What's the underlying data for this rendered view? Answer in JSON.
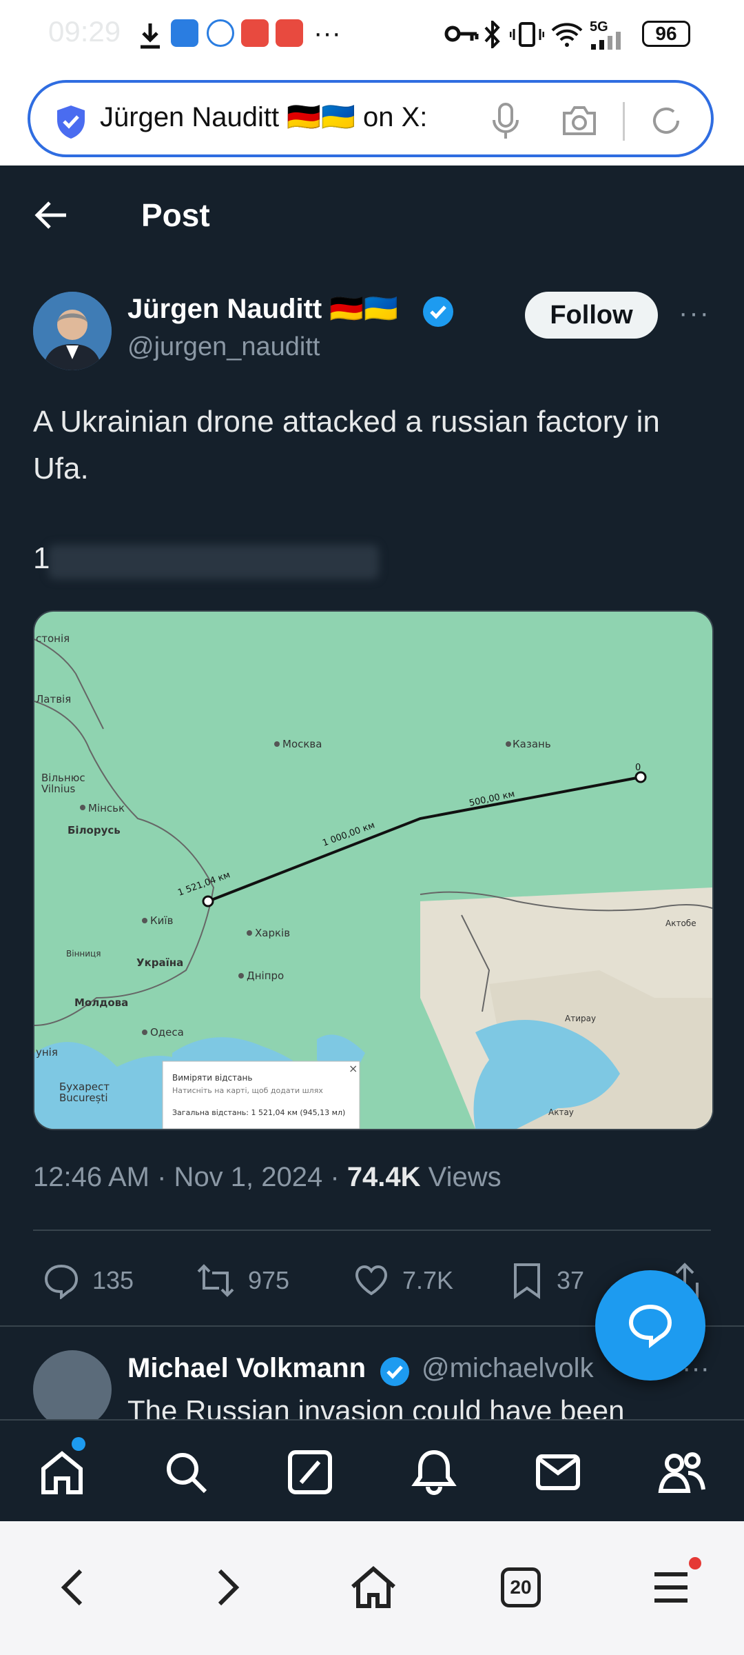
{
  "status_bar": {
    "time": "09:29",
    "battery": "96",
    "network": "5G",
    "more": "···",
    "icons": [
      "download-icon",
      "app-icon",
      "ifly-icon",
      "app-icon",
      "app-icon",
      "key-icon",
      "bluetooth-icon",
      "vibrate-icon",
      "wifi-icon",
      "signal-icon",
      "battery-icon"
    ]
  },
  "browser": {
    "url_text": "Jürgen Nauditt 🇩🇪🇺🇦 on X:",
    "icons": [
      "shield-check-icon",
      "mic-icon",
      "camera-icon",
      "refresh-icon"
    ]
  },
  "header": {
    "title": "Post"
  },
  "post": {
    "author_name": "Jürgen Nauditt",
    "author_flags": "🇩🇪🇺🇦",
    "author_handle": "@jurgen_nauditt",
    "follow_label": "Follow",
    "more": "···",
    "text": "A Ukrainian drone attacked a russian factory in Ufa.",
    "text_line2": "1",
    "timestamp": "12:46 AM · Nov 1, 2024 · ",
    "views_count": "74.4K",
    "views_label": " Views",
    "map": {
      "labels": [
        "стонія",
        "Латвія",
        "Вільнюс",
        "Vilnius",
        "Мінськ",
        "Білорусь",
        "Москва",
        "Казань",
        "Київ",
        "Харків",
        "Україна",
        "Вінниця",
        "Дніпро",
        "Молдова",
        "Одеса",
        "унія",
        "Бухарест",
        "București",
        "Актобе",
        "Атирау",
        "Актау"
      ],
      "distance_labels": [
        "1 521,04 км",
        "1 000,00 км",
        "500,00 км",
        "0"
      ],
      "popup_title": "Виміряти відстань",
      "popup_hint": "Натисніть на карті, щоб додати шлях",
      "popup_total": "Загальна відстань: 1 521,04 км (945,13 мл)",
      "popup_close": "×"
    }
  },
  "actions": {
    "replies": "135",
    "reposts": "975",
    "likes": "7.7K",
    "bookmarks": "37"
  },
  "reply": {
    "name": "Michael Volkmann",
    "handle": "@michaelvolk",
    "text": "The Russian invasion could have been"
  },
  "tabs": [
    "home-icon",
    "search-icon",
    "grok-icon",
    "notifications-icon",
    "messages-icon",
    "communities-icon"
  ],
  "nav": {
    "tabs_count": "20"
  },
  "colors": {
    "background": "#15202b",
    "accent": "#1d9bf0",
    "verified": "#1d9bf0"
  }
}
